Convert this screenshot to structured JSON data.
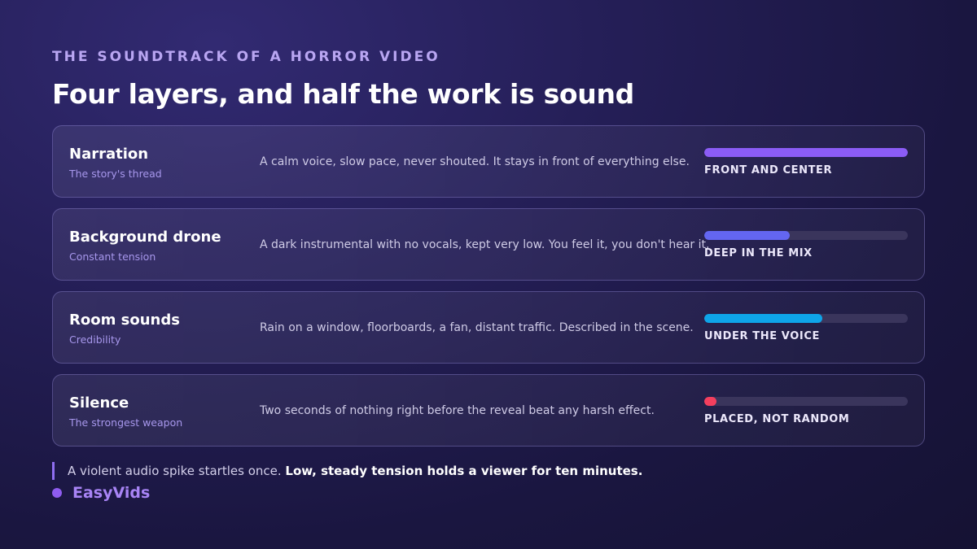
{
  "header": {
    "eyebrow": "THE SOUNDTRACK OF A HORROR VIDEO",
    "title": "Four layers, and half the work is sound"
  },
  "layers": [
    {
      "name": "Narration",
      "subtitle": "The story's thread",
      "description": "A calm voice, slow pace, never shouted. It stays in front of everything else.",
      "level_label": "FRONT AND CENTER",
      "level": 1.0,
      "color": "#8b5cf6"
    },
    {
      "name": "Background drone",
      "subtitle": "Constant tension",
      "description": "A dark instrumental with no vocals, kept very low. You feel it, you don't hear it.",
      "level_label": "DEEP IN THE MIX",
      "level": 0.42,
      "color": "#6366f1"
    },
    {
      "name": "Room sounds",
      "subtitle": "Credibility",
      "description": "Rain on a window, floorboards, a fan, distant traffic. Described in the scene.",
      "level_label": "UNDER THE VOICE",
      "level": 0.58,
      "color": "#0ea5e9"
    },
    {
      "name": "Silence",
      "subtitle": "The strongest weapon",
      "description": "Two seconds of nothing right before the reveal beat any harsh effect.",
      "level_label": "PLACED, NOT RANDOM",
      "level": 0.06,
      "color": "#f43f5e"
    }
  ],
  "footer": {
    "quote_plain": "A violent audio spike startles once. ",
    "quote_bold": "Low, steady tension holds a viewer for ten minutes.",
    "brand": "EasyVids"
  }
}
